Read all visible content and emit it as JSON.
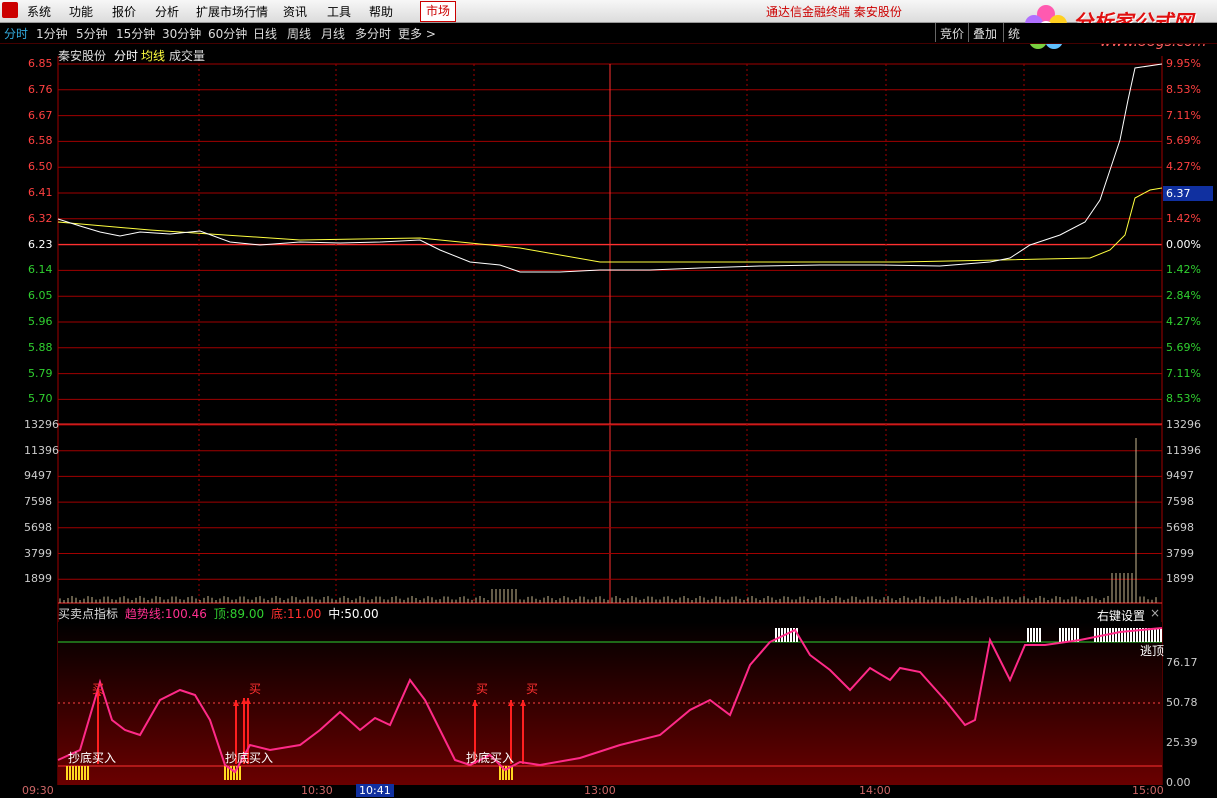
{
  "menubar": {
    "items": [
      "系统",
      "功能",
      "报价",
      "分析",
      "扩展市场行情",
      "资讯",
      "工具",
      "帮助"
    ],
    "market_label": "市场",
    "window_title": "通达信金融终端  秦安股份"
  },
  "brand": {
    "name": "分析家公式网",
    "url": "www.88gs.com"
  },
  "periodbar": {
    "tabs": [
      "分时",
      "1分钟",
      "5分钟",
      "15分钟",
      "30分钟",
      "60分钟",
      "日线",
      "周线",
      "月线",
      "多分时",
      "更多 >"
    ],
    "active": "分时",
    "right_buttons": [
      "竞价",
      "叠加",
      "统"
    ]
  },
  "price_chart": {
    "stock_name": "秦安股份",
    "line_labels": [
      "分时",
      "均线",
      "成交量"
    ],
    "left_price_labels": [
      "6.85",
      "6.76",
      "6.67",
      "6.58",
      "6.50",
      "6.41",
      "6.32",
      "6.23",
      "6.14",
      "6.05",
      "5.96",
      "5.88",
      "5.79",
      "5.70"
    ],
    "right_pct_labels": [
      "9.95%",
      "8.53%",
      "7.11%",
      "5.69%",
      "4.27%",
      "2.84%",
      "1.42%",
      "0.00%",
      "1.42%",
      "2.84%",
      "4.27%",
      "5.69%",
      "7.11%",
      "8.53%"
    ],
    "last_price_tag": "6.37",
    "prev_close": "6.23",
    "colors": {
      "up": "#ff3030",
      "down": "#00d000",
      "flat": "#ffffff",
      "price_line": "#ffffff",
      "avg_line": "#ffff40",
      "grid": "#a00000"
    }
  },
  "volume_chart": {
    "labels": [
      "13296",
      "11396",
      "9497",
      "7598",
      "5698",
      "3799",
      "1899"
    ]
  },
  "indicator": {
    "name": "买卖点指标",
    "fields": [
      {
        "label": "趋势线:",
        "value": "100.46",
        "color": "#ff3090"
      },
      {
        "label": "顶:",
        "value": "89.00",
        "color": "#30d030"
      },
      {
        "label": "底:",
        "value": "11.00",
        "color": "#ff3030"
      },
      {
        "label": "中:",
        "value": "50.00",
        "color": "#ffffff"
      }
    ],
    "right_settings": "右键设置",
    "close_glyph": "×",
    "escape_top": "逃顶",
    "y_labels": [
      "76.17",
      "50.78",
      "25.39",
      "0.00"
    ],
    "buy_marks": [
      "买",
      "买",
      "买",
      "买"
    ],
    "bottom_buy_labels": [
      "抄底买入",
      "抄底买入",
      "抄底买入"
    ]
  },
  "time_axis": {
    "labels": [
      "09:30",
      "10:30",
      "13:00",
      "14:00",
      "15:00"
    ],
    "cursor_label": "10:41"
  }
}
